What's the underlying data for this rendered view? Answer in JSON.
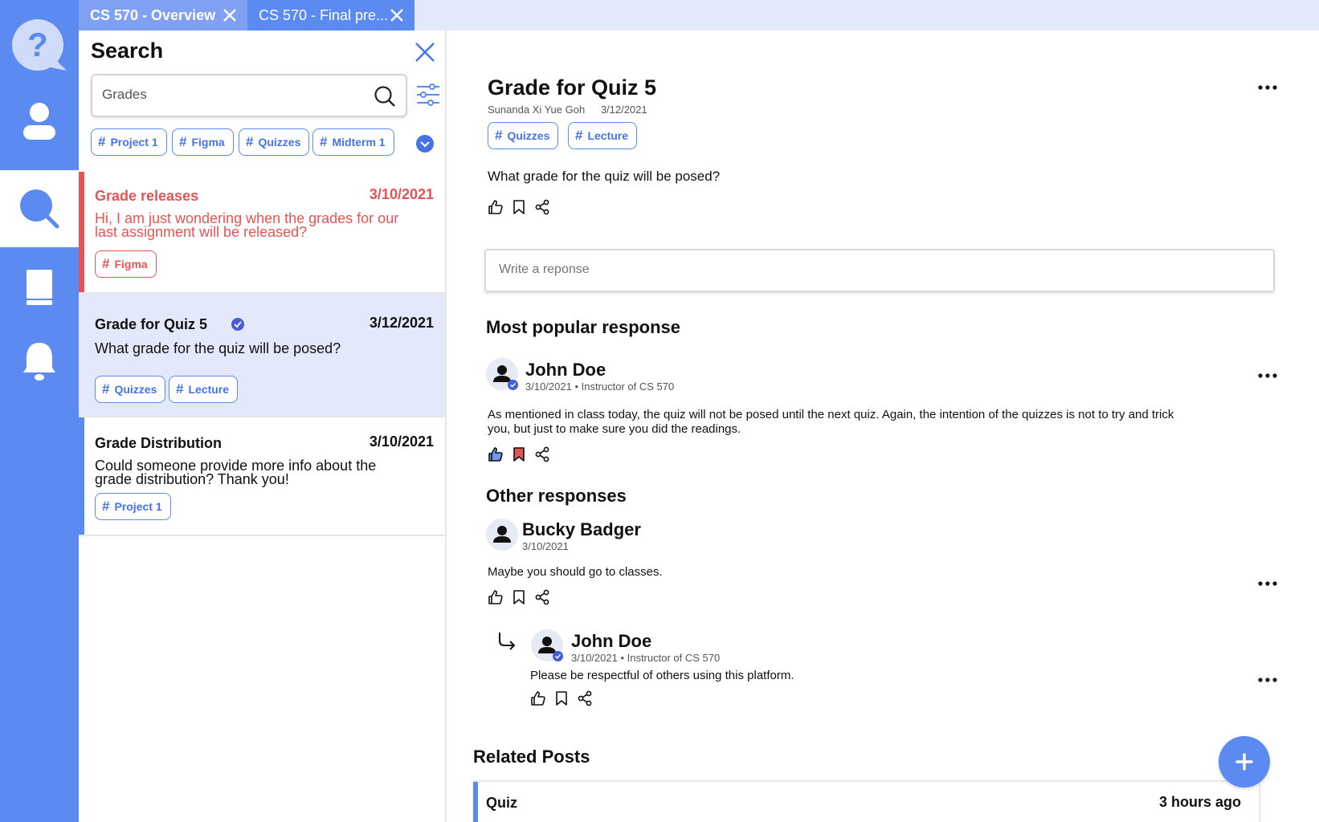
{
  "colors": {
    "accent": "#5b8af0",
    "danger": "#e55454",
    "selected_bg": "#e3e9fb"
  },
  "sidebar": {
    "items": [
      {
        "icon": "help-chat-icon"
      },
      {
        "icon": "user-icon"
      },
      {
        "icon": "search-icon",
        "active": true
      },
      {
        "icon": "book-icon"
      },
      {
        "icon": "bell-icon"
      }
    ]
  },
  "tabs": [
    {
      "label": "CS 570 - Overview",
      "active": true
    },
    {
      "label": "CS 570 - Final pre..."
    }
  ],
  "search": {
    "title": "Search",
    "query": "Grades",
    "filters": [
      "Project 1",
      "Figma",
      "Quizzes",
      "Midterm 1"
    ],
    "results": [
      {
        "title": "Grade releases",
        "date": "3/10/2021",
        "body": "Hi, I am just wondering when the grades for our last assignment will be released?",
        "tags": [
          "Figma"
        ],
        "status": "unread"
      },
      {
        "title": "Grade for Quiz 5",
        "date": "3/12/2021",
        "body": "What grade for the quiz will be posed?",
        "tags": [
          "Quizzes",
          "Lecture"
        ],
        "verified": true,
        "selected": true
      },
      {
        "title": "Grade Distribution",
        "date": "3/10/2021",
        "body": "Could someone provide more info about the grade distribution? Thank you!",
        "tags": [
          "Project 1"
        ]
      }
    ]
  },
  "question": {
    "title": "Grade for Quiz 5",
    "author": "Sunanda Xi Yue Goh",
    "date": "3/12/2021",
    "tags": [
      "Quizzes",
      "Lecture"
    ],
    "body": "What grade for the quiz will be posed?"
  },
  "response_placeholder": "Write a reponse",
  "popular": {
    "heading": "Most popular response",
    "name": "John Doe",
    "meta": "3/10/2021 • Instructor of CS 570",
    "body": "As mentioned in class today, the quiz will not be posed until the next quiz. Again, the intention of the quizzes is not to try and trick you, but just to make sure you did the readings."
  },
  "others": {
    "heading": "Other responses",
    "items": [
      {
        "name": "Bucky Badger",
        "meta": "3/10/2021",
        "body": "Maybe you should go to classes."
      }
    ],
    "reply": {
      "name": "John Doe",
      "meta": "3/10/2021 • Instructor of CS 570",
      "body": "Please be respectful of others using this platform."
    }
  },
  "related": {
    "heading": "Related Posts",
    "items": [
      {
        "title": "Quiz",
        "time": "3 hours ago"
      }
    ]
  }
}
